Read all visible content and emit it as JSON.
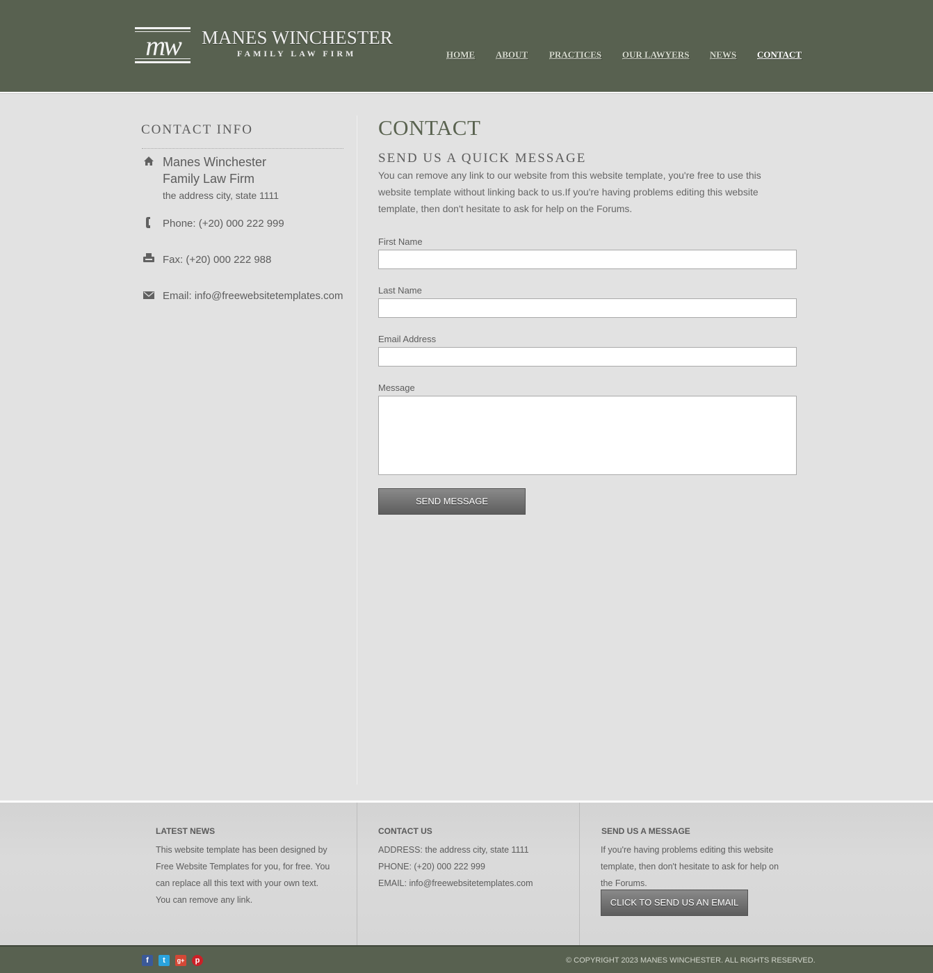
{
  "header": {
    "logo_mark": "mw",
    "logo_name": "MANES WINCHESTER",
    "logo_sub": "FAMILY LAW FIRM",
    "nav": [
      {
        "label": "HOME"
      },
      {
        "label": "ABOUT"
      },
      {
        "label": "PRACTICES"
      },
      {
        "label": "OUR LAWYERS"
      },
      {
        "label": "NEWS"
      },
      {
        "label": "CONTACT",
        "current": true
      }
    ]
  },
  "sidebar": {
    "title": "CONTACT INFO",
    "firm_line1": "Manes Winchester",
    "firm_line2": "Family Law Firm",
    "address": "the address city, state 1111",
    "phone": "Phone: (+20) 000 222 999",
    "fax": "Fax: (+20) 000 222 988",
    "email": "Email: info@freewebsitetemplates.com",
    "icons": [
      "home-icon",
      "phone-icon",
      "fax-icon",
      "mail-icon"
    ]
  },
  "main": {
    "title": "CONTACT",
    "subtitle": "SEND US A QUICK MESSAGE",
    "intro": "You can remove any link to our website from this website template, you're free to use this website template without linking back to us.If you're having problems editing this website template, then don't hesitate to ask for help on the Forums.",
    "form": {
      "first_name_label": "First Name",
      "first_name_value": "",
      "last_name_label": "Last Name",
      "last_name_value": "",
      "email_label": "Email Address",
      "email_value": "",
      "message_label": "Message",
      "message_value": "",
      "submit_label": "SEND MESSAGE"
    }
  },
  "footer": {
    "news_title": "LATEST NEWS",
    "news_text": "This website template has been designed by Free Website Templates for you, for free. You can replace all this text with your own text. You can remove any link.",
    "contact_title": "CONTACT US",
    "contact_address": "ADDRESS: the address city, state 1111",
    "contact_phone": "PHONE: (+20) 000 222 999",
    "contact_email": "EMAIL: info@freewebsitetemplates.com",
    "message_title": "SEND US A MESSAGE",
    "message_text": "If you're having problems editing this website template, then don't hesitate to ask for help on the Forums.",
    "message_button": "CLICK TO SEND US AN EMAIL",
    "social": [
      "facebook-icon",
      "twitter-icon",
      "google-plus-icon",
      "pinterest-icon"
    ],
    "copyright": "© COPYRIGHT 2023 MANES WINCHESTER. ALL RIGHTS RESERVED."
  },
  "colors": {
    "header_bg": "#586150",
    "page_bg": "#e2e2e2",
    "title_green": "#5a6350",
    "button_grey": "#6e6e6e"
  }
}
